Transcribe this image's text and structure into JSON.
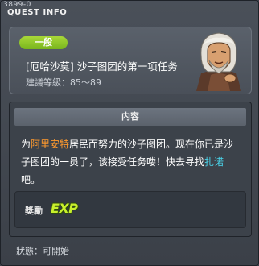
{
  "window": {
    "quest_id": "3899-0",
    "title": "QUEST INFO",
    "close_label": "✕"
  },
  "quest": {
    "badge": "一般",
    "name": "[厄哈沙莫] 沙子图团的第一项任务",
    "level_label": "建議等級：85～89"
  },
  "content": {
    "header": "内容",
    "desc_part1": "为",
    "desc_highlight1": "阿里安特",
    "desc_part2": "居民而努力的沙子图团。现在你已是沙子图团的一员了，该接受任务喽！快去寻找",
    "desc_highlight2": "扎诺",
    "desc_part3": "吧。"
  },
  "reward": {
    "label": "獎勵",
    "exp_text": "EXP"
  },
  "status": {
    "text": "狀態：可開始"
  },
  "colors": {
    "badge": "#8bc528",
    "highlight_orange": "#ff9a2e",
    "highlight_cyan": "#4ad6ec",
    "exp": "#c8f02c"
  }
}
